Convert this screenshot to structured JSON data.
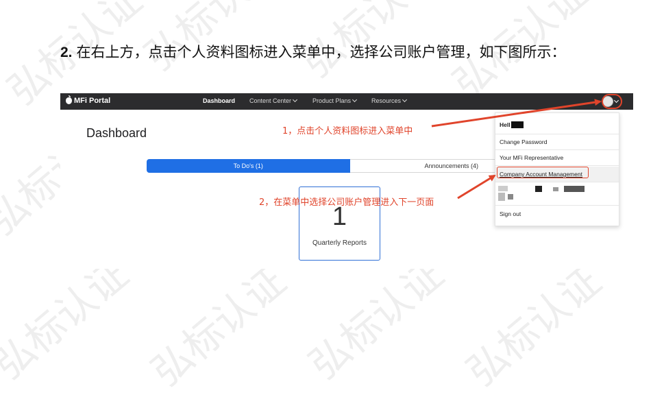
{
  "heading": {
    "number": "2.",
    "text": "在右上方，点击个人资料图标进入菜单中，选择公司账户管理，如下图所示："
  },
  "topnav": {
    "brand": "MFi Portal",
    "items": [
      "Dashboard",
      "Content Center",
      "Product Plans",
      "Resources"
    ],
    "active": "Dashboard"
  },
  "page": {
    "title": "Dashboard",
    "tabs": [
      "To Do's (1)",
      "Announcements (4)"
    ],
    "card": {
      "count": "1",
      "label": "Quarterly Reports"
    }
  },
  "dropdown": {
    "hello": "Hell",
    "items": [
      "Change Password",
      "Your MFi Representative",
      "Company Account Management",
      "Sign out"
    ]
  },
  "annotations": [
    "1，点击个人资料图标进入菜单中",
    "2，在菜单中选择公司账户管理进入下一页面"
  ],
  "colors": {
    "navbar": "#2c2c2e",
    "tab_active": "#1f6fe5",
    "annotation": "#e0442b",
    "card_border": "#2f6fd6"
  },
  "watermark": "弘标认证"
}
